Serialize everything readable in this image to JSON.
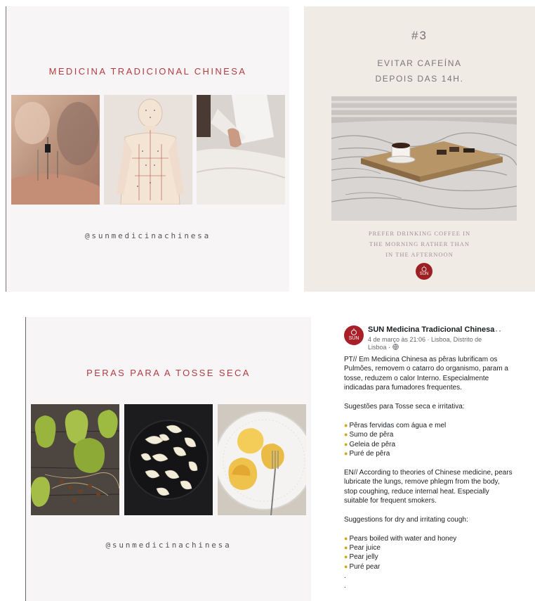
{
  "card1": {
    "title": "MEDICINA TRADICIONAL CHINESA",
    "handle": "@sunmedicinachinesa"
  },
  "card2": {
    "number": "#3",
    "tip_line1": "EVITAR CAFEÍNA",
    "tip_line2": "DEPOIS DAS 14H.",
    "caption_line1": "PREFER DRINKING COFFEE IN",
    "caption_line2": "THE MORNING RATHER THAN",
    "caption_line3": "IN THE AFTERNOON",
    "logo_text": "SUN"
  },
  "card3": {
    "title": "PERAS PARA A TOSSE SECA",
    "handle": "@sunmedicinachinesa"
  },
  "post": {
    "avatar_text": "SUN",
    "page_name": "SUN Medicina Tradicional Chinesa",
    "meta": "4 de março às 21:06 · Lisboa, Distrito de Lisboa ·",
    "more": "···",
    "pt_text": "PT// Em Medicina Chinesa as pêras lubrificam os Pulmões, removem o catarro do organismo, param a tosse, reduzem o calor Interno. Especialmente indicadas para fumadores frequentes.",
    "pt_heading": "Sugestões para Tosse seca e irritativa:",
    "pt_items": [
      "Pêras fervidas com água e mel",
      "Sumo de pêra",
      "Geleia de pêra",
      "Puré de pêra"
    ],
    "en_text": "EN// According to theories of Chinese medicine, pears lubricate the lungs, remove phlegm from the body, stop coughing, reduce internal heat. Especially suitable for frequent smokers.",
    "en_heading": "Suggestions for dry and irritating cough:",
    "en_items": [
      "Pears boiled with water and honey",
      "Pear juice",
      "Pear jelly",
      "Puré pear"
    ],
    "trail1": ".",
    "trail2": "."
  }
}
